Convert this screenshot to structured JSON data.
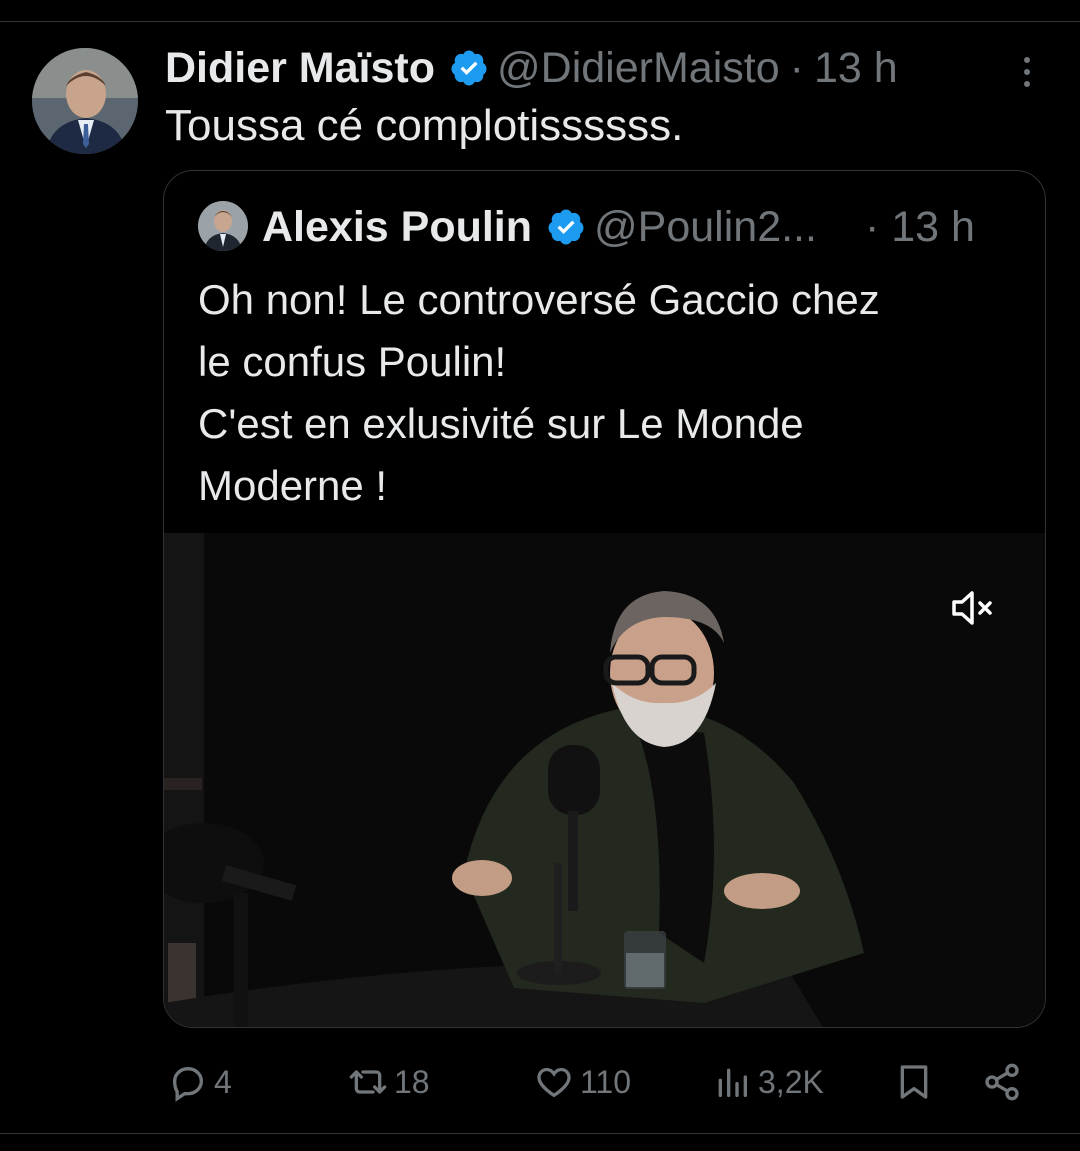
{
  "tweet": {
    "author_name": "Didier Maïsto",
    "author_handle": "@DidierMaisto",
    "separator": "·",
    "time": "13 h",
    "text": "Toussa cé complotissssss."
  },
  "quoted_tweet": {
    "author_name": "Alexis Poulin",
    "author_handle": "@Poulin2...",
    "time": "· 13 h",
    "text_lines": [
      "Oh non! Le controversé Gaccio chez",
      "le confus Poulin!",
      "C'est en exlusivité sur Le Monde",
      "Moderne !"
    ]
  },
  "actions": {
    "replies": "4",
    "retweets": "18",
    "likes": "110",
    "views": "3,2K"
  },
  "colors": {
    "background": "#000000",
    "text_primary": "#e7e9ea",
    "text_secondary": "#71767b",
    "verified": "#1d9bf0",
    "border": "#2f3336"
  },
  "icons": [
    "verified-badge-icon",
    "more-options-icon",
    "mute-icon",
    "reply-icon",
    "retweet-icon",
    "like-icon",
    "views-icon",
    "bookmark-icon",
    "share-icon"
  ]
}
